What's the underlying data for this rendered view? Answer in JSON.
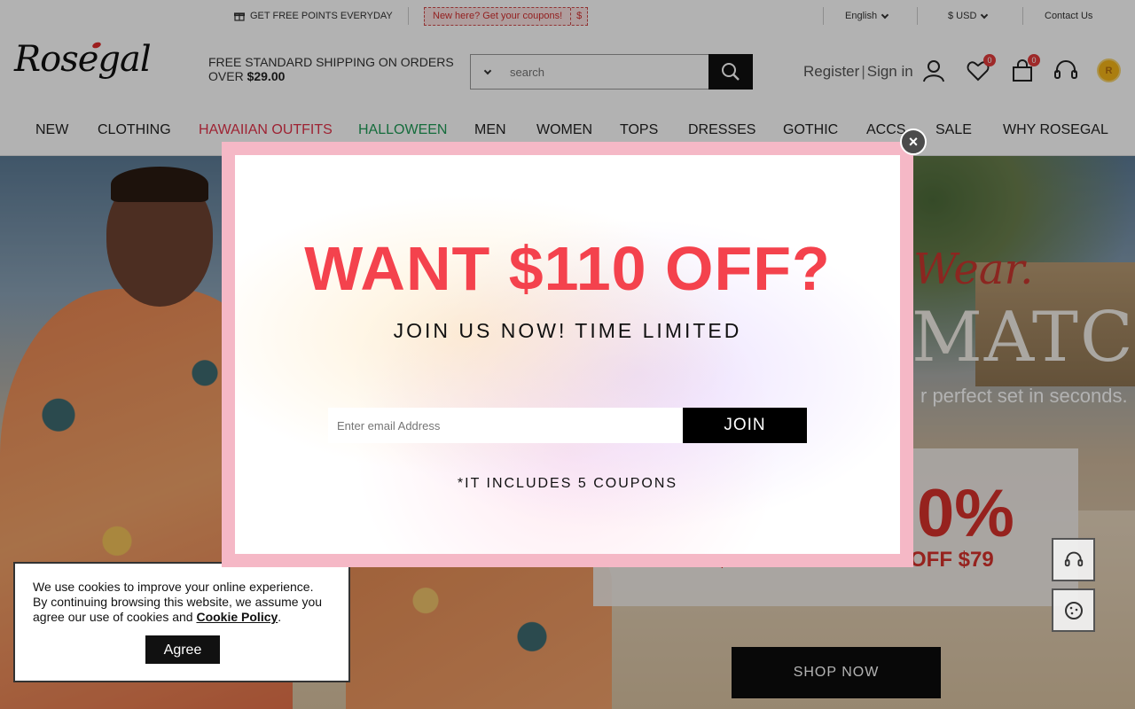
{
  "topbar": {
    "points_text": "GET FREE POINTS EVERYDAY",
    "coupon_text": "New here? Get your coupons!",
    "coupon_symbol": "$",
    "language": "English",
    "currency": "$ USD",
    "contact": "Contact Us"
  },
  "header": {
    "logo": "Rosegal",
    "shipping_line1": "FREE STANDARD SHIPPING ON ORDERS",
    "shipping_line2_prefix": "OVER ",
    "shipping_amount": "$29.00",
    "search_placeholder": "search",
    "register": "Register",
    "signin": "Sign in",
    "wishlist_count": "0",
    "cart_count": "0",
    "coin_letter": "R"
  },
  "nav": {
    "items": [
      {
        "label": "NEW",
        "color": "#222222"
      },
      {
        "label": "CLOTHING",
        "color": "#222222"
      },
      {
        "label": "HAWAIIAN OUTFITS",
        "color": "#e2334a"
      },
      {
        "label": "HALLOWEEN",
        "color": "#1f9b56"
      },
      {
        "label": "MEN",
        "color": "#222222"
      },
      {
        "label": "WOMEN",
        "color": "#222222"
      },
      {
        "label": "TOPS",
        "color": "#222222"
      },
      {
        "label": "DRESSES",
        "color": "#222222"
      },
      {
        "label": "GOTHIC",
        "color": "#222222"
      },
      {
        "label": "ACCS",
        "color": "#222222"
      },
      {
        "label": "SALE",
        "color": "#222222"
      },
      {
        "label": "WHY ROSEGAL",
        "color": "#222222"
      }
    ]
  },
  "hero": {
    "cursive": "Wear.",
    "match": "MATCH",
    "tagline": "r perfect set in seconds.",
    "percent": "0%",
    "off_left": "OFF $79",
    "off_right": "OFF $79",
    "shop_now": "SHOP NOW"
  },
  "popup": {
    "headline": "WANT $110 OFF?",
    "subheadline": "JOIN US NOW! TIME LIMITED",
    "email_placeholder": "Enter email Address",
    "join_label": "JOIN",
    "note": "*IT INCLUDES 5 COUPONS",
    "close_label": "×"
  },
  "cookie": {
    "text": "We use cookies to improve your online experience. By continuing browsing this website, we assume you agree our use of cookies and ",
    "link": "Cookie Policy",
    "end": ".",
    "agree_label": "Agree"
  },
  "colors": {
    "accent_red": "#f4424d",
    "popup_border": "#f5b8c6"
  }
}
